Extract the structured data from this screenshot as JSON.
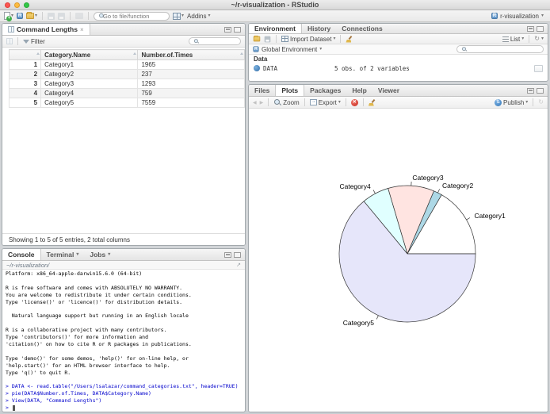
{
  "window": {
    "title": "~/r-visualization - RStudio"
  },
  "toolbar": {
    "goto_placeholder": "Go to file/function",
    "addins_label": "Addins",
    "project_label": "r-visualization"
  },
  "icons": {
    "caret": "▾",
    "close": "×",
    "refresh": "↻",
    "back": "◀",
    "forward": "▶",
    "open_link": "↗"
  },
  "data_viewer": {
    "tab_title": "Command Lengths",
    "filter_label": "Filter",
    "columns": [
      "Category.Name",
      "Number.of.Times"
    ],
    "rows": [
      [
        "1",
        "Category1",
        "1965"
      ],
      [
        "2",
        "Category2",
        "237"
      ],
      [
        "3",
        "Category3",
        "1293"
      ],
      [
        "4",
        "Category4",
        "759"
      ],
      [
        "5",
        "Category5",
        "7559"
      ]
    ],
    "status": "Showing 1 to 5 of 5 entries, 2 total columns"
  },
  "console": {
    "tabs": [
      "Console",
      "Terminal",
      "Jobs"
    ],
    "path": "~/r-visualization/",
    "output_lines": [
      "Platform: x86_64-apple-darwin15.6.0 (64-bit)",
      "",
      "R is free software and comes with ABSOLUTELY NO WARRANTY.",
      "You are welcome to redistribute it under certain conditions.",
      "Type 'license()' or 'licence()' for distribution details.",
      "",
      "  Natural language support but running in an English locale",
      "",
      "R is a collaborative project with many contributors.",
      "Type 'contributors()' for more information and",
      "'citation()' on how to cite R or R packages in publications.",
      "",
      "Type 'demo()' for some demos, 'help()' for on-line help, or",
      "'help.start()' for an HTML browser interface to help.",
      "Type 'q()' to quit R.",
      ""
    ],
    "commands": [
      "> DATA <- read.table(\"/Users/lsalazar/command_categories.txt\", header=TRUE)",
      "> pie(DATA$Number.of.Times, DATA$Category.Name)",
      "> View(DATA, \"Command Lengths\")"
    ],
    "prompt": ">"
  },
  "environment": {
    "tabs": [
      "Environment",
      "History",
      "Connections"
    ],
    "import_label": "Import Dataset",
    "list_label": "List",
    "scope_label": "Global Environment",
    "section_label": "Data",
    "entries": [
      {
        "name": "DATA",
        "desc": "5 obs. of 2 variables"
      }
    ]
  },
  "plots": {
    "tabs": [
      "Files",
      "Plots",
      "Packages",
      "Help",
      "Viewer"
    ],
    "zoom_label": "Zoom",
    "export_label": "Export",
    "publish_label": "Publish"
  },
  "chart_data": {
    "type": "pie",
    "title": "",
    "categories": [
      "Category1",
      "Category2",
      "Category3",
      "Category4",
      "Category5"
    ],
    "values": [
      1965,
      237,
      1293,
      759,
      7559
    ],
    "colors": [
      "#FFFFFF",
      "#ADD8E6",
      "#FFE4E1",
      "#E0FFFF",
      "#E6E6FA"
    ],
    "start_angle_deg": 0,
    "direction": "counterclockwise",
    "center": [
      200,
      183
    ],
    "radius": 86
  }
}
